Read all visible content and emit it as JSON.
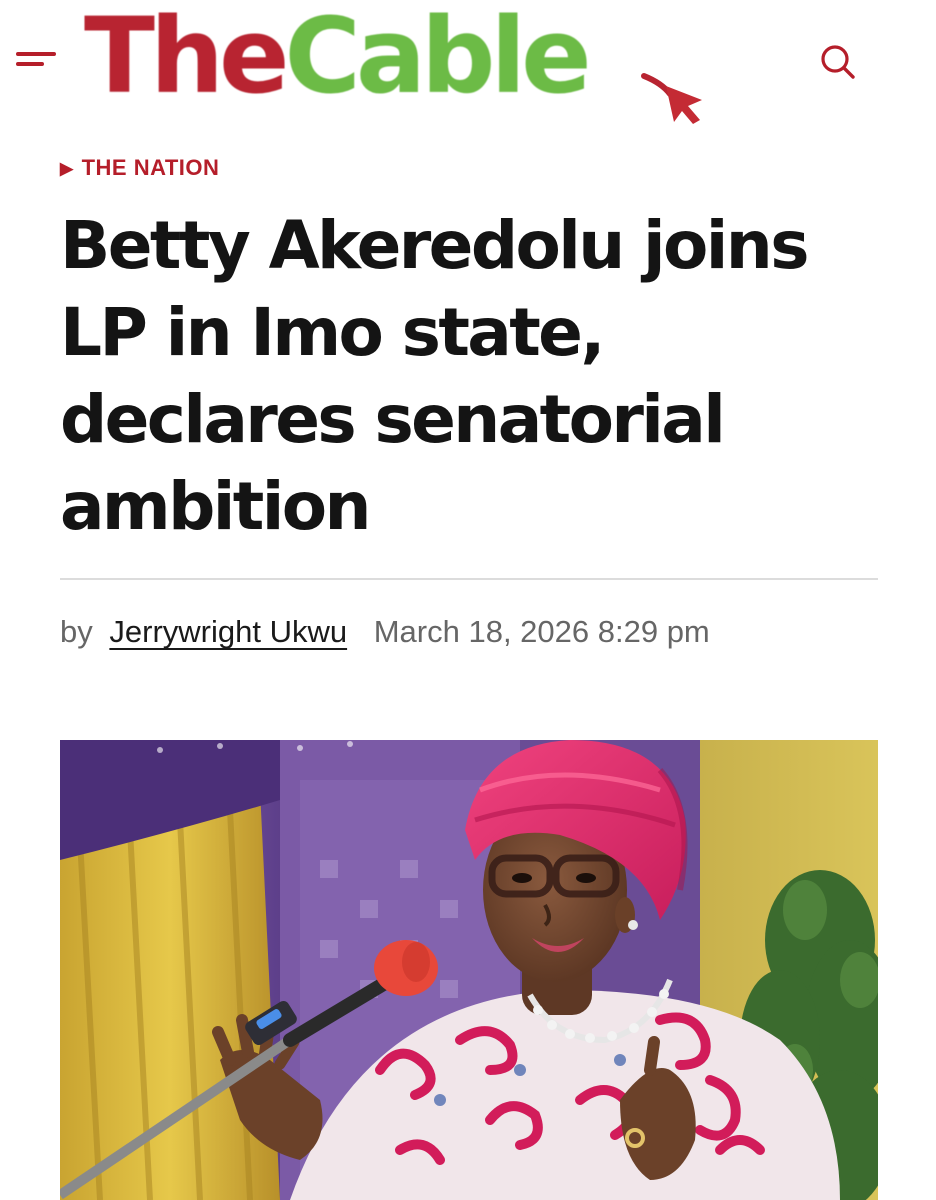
{
  "header": {
    "logo_part1": "The",
    "logo_part2": "Cable",
    "menu_icon": "hamburger-menu-icon",
    "search_icon": "search-icon",
    "brand_colors": {
      "red": "#b82431",
      "green": "#6cbb46"
    }
  },
  "article": {
    "category": "THE NATION",
    "headline": "Betty Akeredolu joins LP in Imo state, declares senatorial ambition",
    "byline_prefix": "by",
    "author": "Jerrywright Ukwu",
    "date": "March 18, 2026 8:29 pm"
  },
  "photo": {
    "kind": "woman in pink headwrap speaking at microphone"
  },
  "colors": {
    "accent": "#b51e2a",
    "headline": "#141414",
    "meta": "#666666",
    "divider": "#dcdcdc"
  }
}
